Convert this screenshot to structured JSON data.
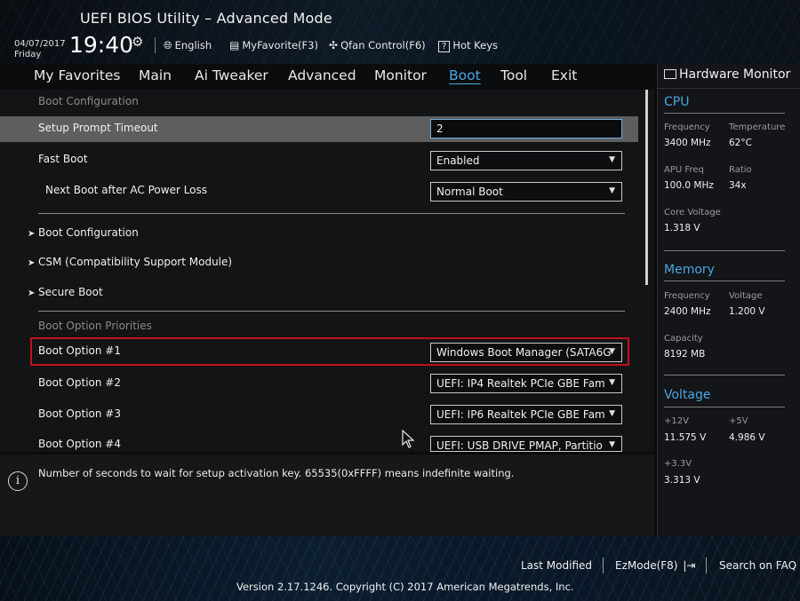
{
  "header": {
    "title": "UEFI BIOS Utility – Advanced Mode",
    "date": "04/07/2017",
    "day": "Friday",
    "time": "19:40",
    "language": "English",
    "my_favorite": "MyFavorite(F3)",
    "qfan": "Qfan Control(F6)",
    "hot_keys": "Hot Keys"
  },
  "menu": {
    "items": [
      "My Favorites",
      "Main",
      "Ai Tweaker",
      "Advanced",
      "Monitor",
      "Boot",
      "Tool",
      "Exit"
    ],
    "active": "Boot"
  },
  "boot": {
    "section_config": "Boot Configuration",
    "setup_prompt_label": "Setup Prompt Timeout",
    "setup_prompt_value": "2",
    "fast_boot_label": "Fast Boot",
    "fast_boot_value": "Enabled",
    "next_boot_label": "Next Boot after AC Power Loss",
    "next_boot_value": "Normal Boot",
    "submenus": [
      "Boot Configuration",
      "CSM (Compatibility Support Module)",
      "Secure Boot"
    ],
    "section_priorities": "Boot Option Priorities",
    "options": [
      {
        "label": "Boot Option #1",
        "value": "Windows Boot Manager (SATA6G"
      },
      {
        "label": "Boot Option #2",
        "value": "UEFI: IP4 Realtek PCIe GBE Fam"
      },
      {
        "label": "Boot Option #3",
        "value": "UEFI: IP6 Realtek PCIe GBE Fam"
      },
      {
        "label": "Boot Option #4",
        "value": "UEFI: USB DRIVE PMAP, Partitio"
      }
    ]
  },
  "help": {
    "text": "Number of seconds to wait for setup activation key. 65535(0xFFFF) means indefinite waiting."
  },
  "hardware_monitor": {
    "title": "Hardware Monitor",
    "cpu": {
      "heading": "CPU",
      "frequency_label": "Frequency",
      "frequency_value": "3400 MHz",
      "temperature_label": "Temperature",
      "temperature_value": "62°C",
      "apu_freq_label": "APU Freq",
      "apu_freq_value": "100.0 MHz",
      "ratio_label": "Ratio",
      "ratio_value": "34x",
      "core_voltage_label": "Core Voltage",
      "core_voltage_value": "1.318 V"
    },
    "memory": {
      "heading": "Memory",
      "frequency_label": "Frequency",
      "frequency_value": "2400 MHz",
      "voltage_label": "Voltage",
      "voltage_value": "1.200 V",
      "capacity_label": "Capacity",
      "capacity_value": "8192 MB"
    },
    "voltage": {
      "heading": "Voltage",
      "v12_label": "+12V",
      "v12_value": "11.575 V",
      "v5_label": "+5V",
      "v5_value": "4.986 V",
      "v33_label": "+3.3V",
      "v33_value": "3.313 V"
    }
  },
  "footer": {
    "last_modified": "Last Modified",
    "ezmode": "EzMode(F8)",
    "search_faq": "Search on FAQ",
    "version": "Version 2.17.1246. Copyright (C) 2017 American Megatrends, Inc."
  },
  "colors": {
    "accent": "#4aa8e6",
    "selection_border": "#c0111a",
    "highlight_row": "#5e5e5e"
  }
}
